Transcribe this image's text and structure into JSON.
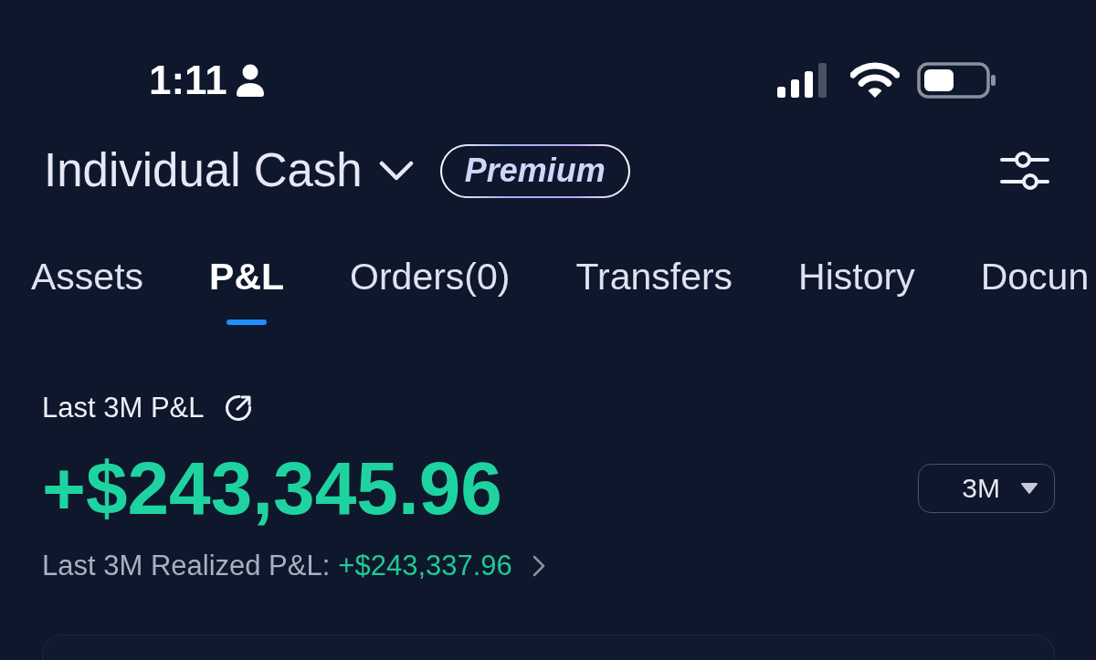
{
  "status_bar": {
    "time": "1:11"
  },
  "header": {
    "account": "Individual Cash",
    "badge": "Premium"
  },
  "tabs": [
    {
      "label": "Assets",
      "selected": false
    },
    {
      "label": "P&L",
      "selected": true
    },
    {
      "label": "Orders(0)",
      "selected": false
    },
    {
      "label": "Transfers",
      "selected": false
    },
    {
      "label": "History",
      "selected": false
    },
    {
      "label": "Docun",
      "selected": false
    }
  ],
  "pnl": {
    "title": "Last 3M P&L",
    "amount": "+$243,345.96",
    "period": "3M",
    "realized_label": "Last 3M Realized P&L:",
    "realized_value": "+$243,337.96"
  }
}
